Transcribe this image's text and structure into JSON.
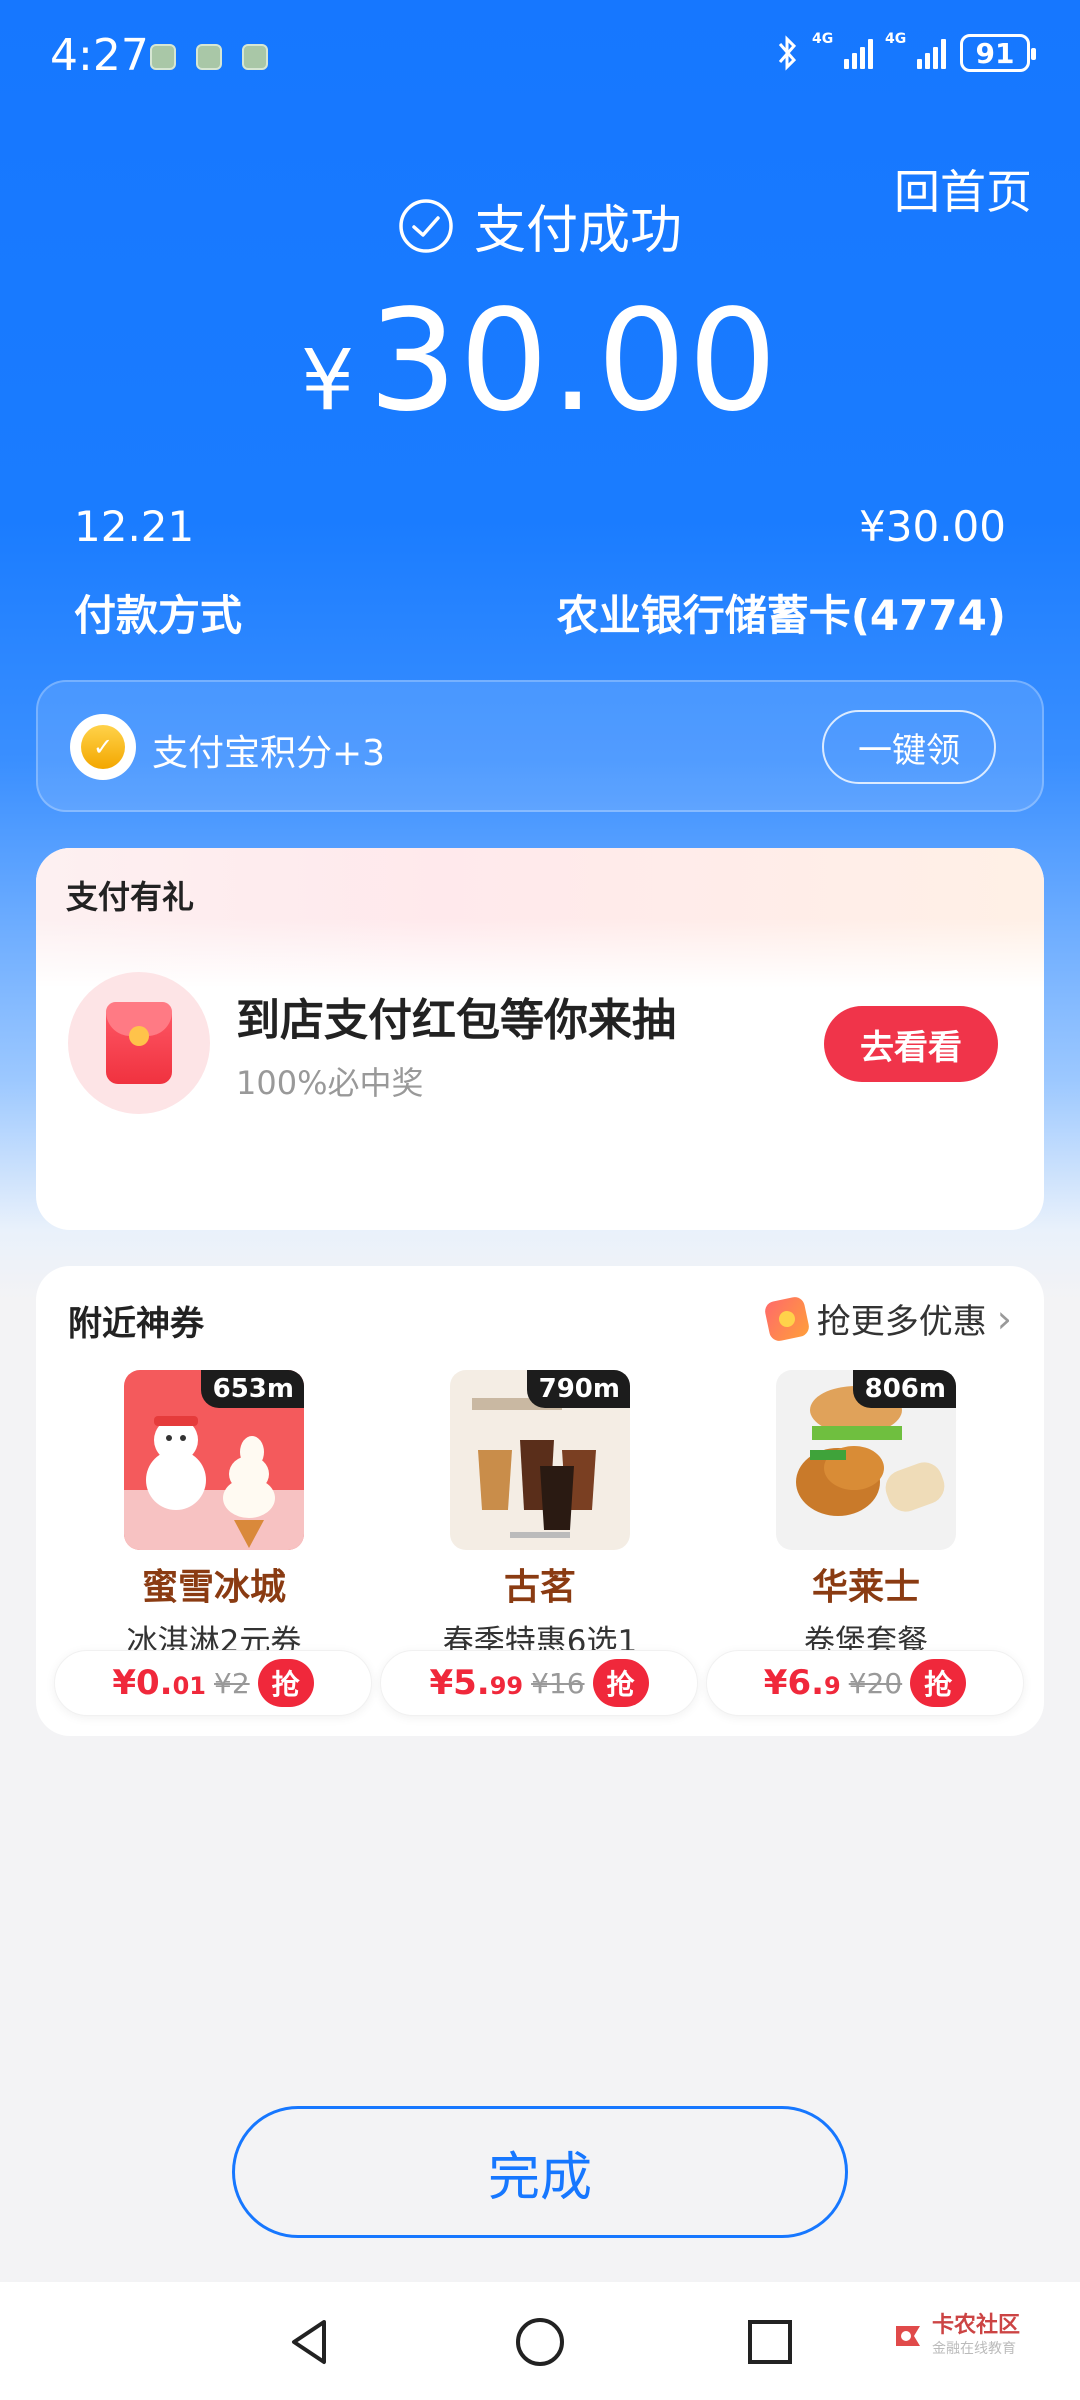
{
  "status_bar": {
    "time": "4:27",
    "battery": "91",
    "network_1": "4G",
    "network_2": "4G"
  },
  "header": {
    "home_link": "回首页",
    "success_text": "支付成功",
    "currency": "¥",
    "amount": "30.00"
  },
  "details": {
    "date": "12.21",
    "amount": "¥30.00",
    "method_label": "付款方式",
    "method_value": "农业银行储蓄卡(4774)"
  },
  "points": {
    "text": "支付宝积分+3",
    "button": "一键领"
  },
  "gift": {
    "title": "支付有礼",
    "main": "到店支付红包等你来抽",
    "sub": "100%必中奖",
    "button": "去看看"
  },
  "coupons": {
    "title": "附近神券",
    "more": "抢更多优惠",
    "items": [
      {
        "distance": "653m",
        "name": "蜜雪冰城",
        "desc": "冰淇淋2元券",
        "price_int": "¥0.",
        "price_dec": "01",
        "old_price": "¥2",
        "grab": "抢"
      },
      {
        "distance": "790m",
        "name": "古茗",
        "desc": "春季特惠6选1",
        "price_int": "¥5.",
        "price_dec": "99",
        "old_price": "¥16",
        "grab": "抢"
      },
      {
        "distance": "806m",
        "name": "华莱士",
        "desc": "卷堡套餐",
        "price_int": "¥6.",
        "price_dec": "9",
        "old_price": "¥20",
        "grab": "抢"
      }
    ]
  },
  "done_button": "完成",
  "watermark": {
    "line1": "卡农社区",
    "line2": "金融在线教育"
  },
  "colors": {
    "primary": "#1677ff",
    "accent_red": "#f0283b",
    "brand_brown": "#8a3b12"
  }
}
